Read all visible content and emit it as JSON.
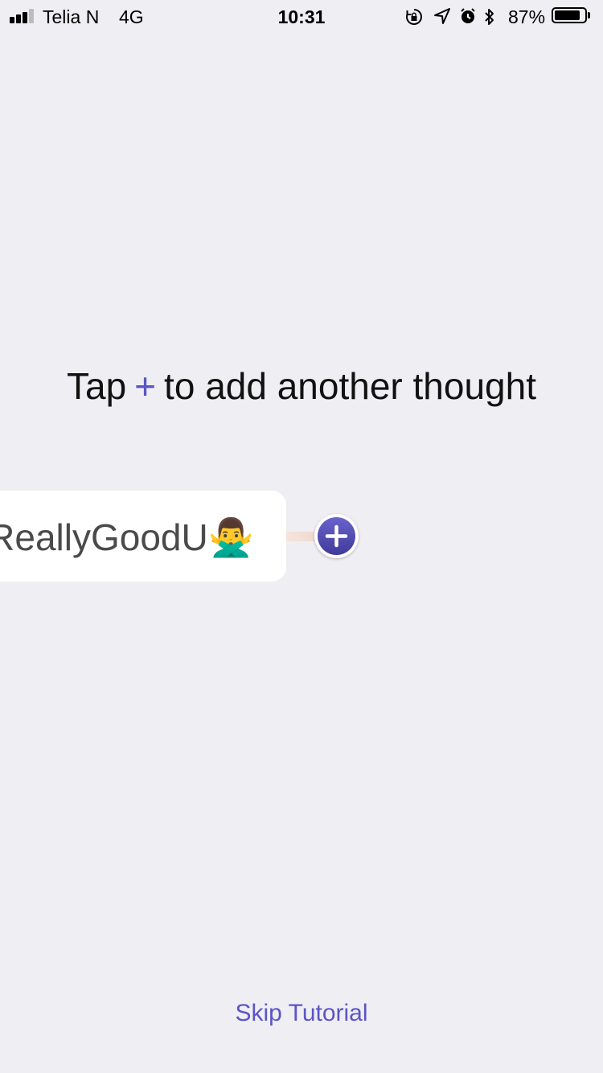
{
  "status_bar": {
    "carrier": "Telia N",
    "network": "4G",
    "time": "10:31",
    "battery_percent": "87%",
    "battery_level": 0.87,
    "signal_bars_filled": 3,
    "signal_bars_total": 4,
    "icons": [
      "rotation-lock-icon",
      "location-icon",
      "alarm-icon",
      "bluetooth-icon",
      "battery-icon"
    ]
  },
  "hint": {
    "prefix": "Tap",
    "plus_symbol": "+",
    "suffix": "to add another thought"
  },
  "thought_node": {
    "text": "ReallyGoodU🙅‍♂️"
  },
  "actions": {
    "skip_label": "Skip Tutorial"
  },
  "colors": {
    "background": "#EFEEF3",
    "accent": "#5B55C4"
  }
}
